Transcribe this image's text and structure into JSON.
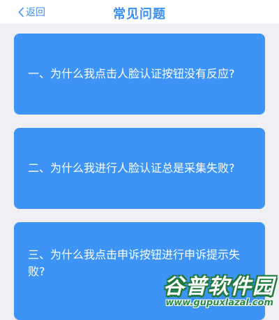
{
  "nav": {
    "back_label": "返回",
    "title": "常见问题"
  },
  "faq": [
    {
      "question": "一、为什么我点击人脸认证按钮没有反应?"
    },
    {
      "question": "二、为什么我进行人脸认证总是采集失败?"
    },
    {
      "question": "三、为什么我点击申诉按钮进行申诉提示失败?"
    }
  ],
  "watermark": {
    "logo_text": "谷普软件园",
    "url": "www.gupuxlazal.com"
  },
  "colors": {
    "accent": "#3b8ff0",
    "card": "#3d94f5",
    "background": "#efeff4",
    "watermark": "#2a8a45"
  }
}
